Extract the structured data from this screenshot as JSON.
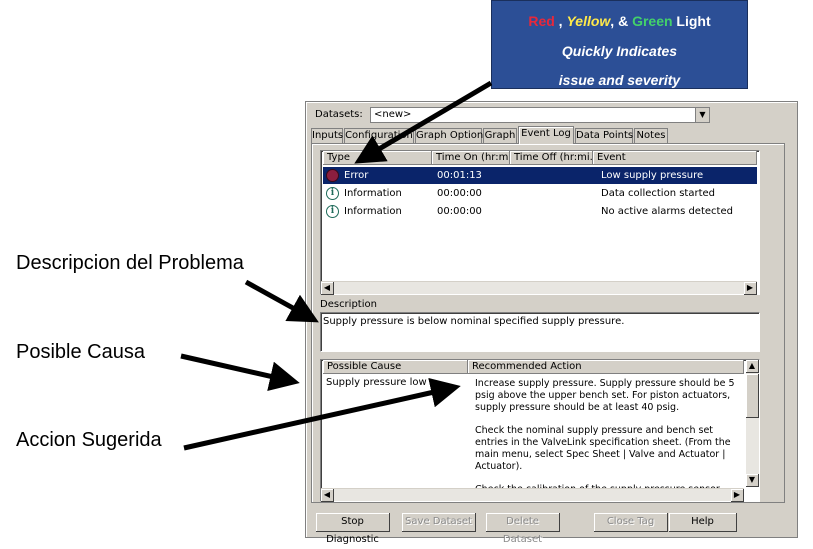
{
  "callout": {
    "red": "Red",
    "sep1": " , ",
    "yellow": "Yellow",
    "sep2": ", & ",
    "green": "Green",
    "light": " Light",
    "line2": "Quickly Indicates",
    "line3": "issue and severity"
  },
  "annotations": {
    "problem": "Descripcion del Problema",
    "cause": "Posible Causa",
    "action": "Accion Sugerida"
  },
  "dialog": {
    "datasets_label": "Datasets:",
    "datasets_value": "<new>",
    "tabs": [
      "Inputs",
      "Configuration",
      "Graph Options",
      "Graph",
      "Event Log",
      "Data Points",
      "Notes"
    ],
    "active_tab": "Event Log",
    "event_columns": [
      "Type",
      "Time On (hr:mi...",
      "Time Off (hr:mi...",
      "Event"
    ],
    "events": [
      {
        "type": "Error",
        "time_on": "00:01:13",
        "time_off": "",
        "event": "Low supply pressure",
        "icon": "error-icon"
      },
      {
        "type": "Information",
        "time_on": "00:00:00",
        "time_off": "",
        "event": "Data collection started",
        "icon": "info-icon"
      },
      {
        "type": "Information",
        "time_on": "00:00:00",
        "time_off": "",
        "event": "No active alarms detected",
        "icon": "info-icon"
      }
    ],
    "description_label": "Description",
    "description_text": "Supply pressure is below nominal specified supply pressure.",
    "cause_columns": [
      "Possible Cause",
      "Recommended Action"
    ],
    "possible_cause": "Supply pressure low",
    "recommended_action": [
      "Increase supply pressure.  Supply pressure should be 5 psig above the upper bench set.  For piston actuators, supply pressure should be at least 40 psig.",
      "Check the nominal supply pressure and bench set entries in the ValveLink specification sheet.  (From the main menu, select Spec Sheet | Valve and Actuator | Actuator).",
      "Check the calibration of the supply pressure sensor."
    ],
    "buttons": {
      "stop_diagnostic": "Stop Diagnostic",
      "save_dataset": "Save Dataset",
      "delete_dataset": "Delete Dataset",
      "close_tag": "Close Tag",
      "help": "Help"
    }
  },
  "colors": {
    "callout_bg": "#2c4f96",
    "red": "#e8283b",
    "yellow": "#ffe94a",
    "green": "#43d16a",
    "selection": "#0a246a"
  }
}
